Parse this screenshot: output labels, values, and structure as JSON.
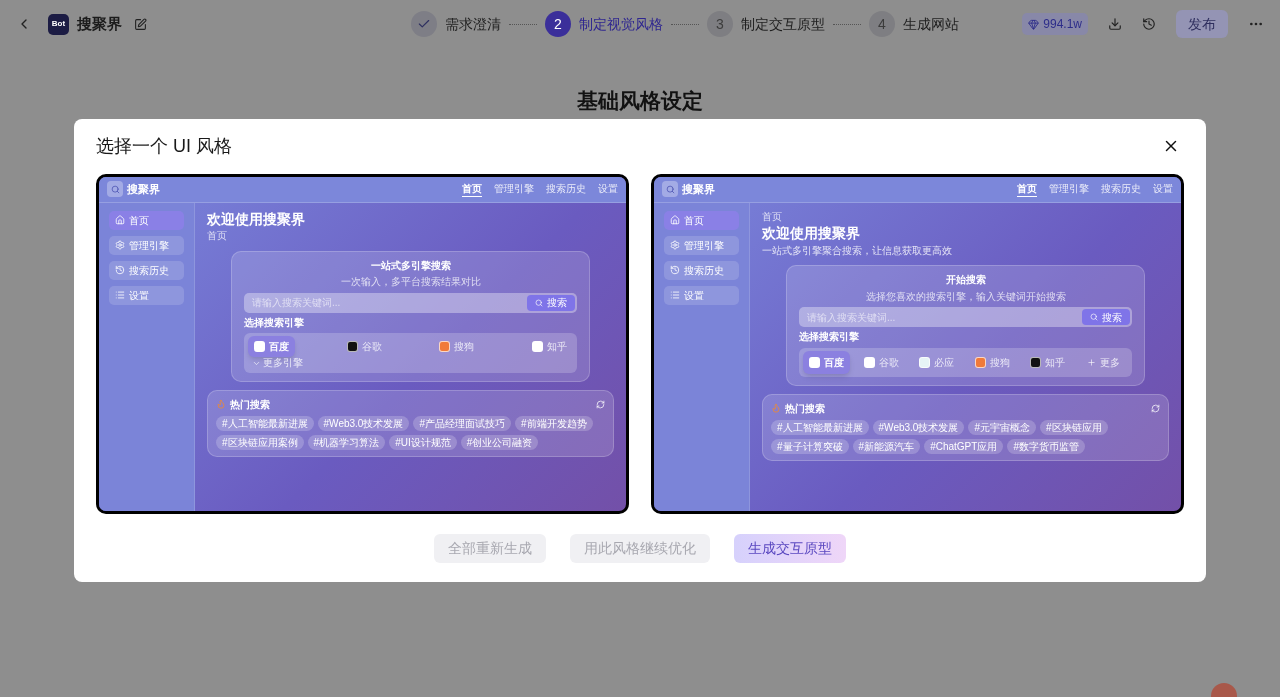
{
  "header": {
    "badge": "Bot",
    "title": "搜聚界",
    "steps": [
      {
        "kind": "done",
        "label": "需求澄清"
      },
      {
        "kind": "active",
        "number": "2",
        "label": "制定视觉风格"
      },
      {
        "kind": "pending",
        "number": "3",
        "label": "制定交互原型"
      },
      {
        "kind": "pending",
        "number": "4",
        "label": "生成网站"
      }
    ],
    "credits": "994.1w",
    "publish": {
      "label": "发布",
      "disabled": true
    }
  },
  "page_title": "基础风格设定",
  "modal": {
    "title": "选择一个 UI 风格",
    "styles": [
      {
        "kind": "title_first",
        "brand": "搜聚界",
        "nav": [
          {
            "label": "首页",
            "selected": true
          },
          {
            "label": "管理引擎",
            "selected": false
          },
          {
            "label": "搜索历史",
            "selected": false
          },
          {
            "label": "设置",
            "selected": false
          }
        ],
        "sidebar": [
          {
            "kind": "home",
            "label": "首页",
            "selected": true
          },
          {
            "kind": "gear",
            "label": "管理引擎",
            "selected": false
          },
          {
            "kind": "history",
            "label": "搜索历史",
            "selected": false
          },
          {
            "kind": "list",
            "label": "设置",
            "selected": false
          }
        ],
        "title": "欢迎使用搜聚界",
        "breadcrumb": "首页",
        "search": {
          "title": "一站式多引擎搜索",
          "subtitle": "一次输入，多平台搜索结果对比",
          "placeholder": "请输入搜索关键词...",
          "button": "搜索",
          "engines_label": "选择搜索引擎",
          "engines": [
            {
              "kind": "engine",
              "label": "百度",
              "selected": true,
              "color": "#ffffff"
            },
            {
              "kind": "engine",
              "label": "谷歌",
              "selected": false,
              "color": "#111111"
            },
            {
              "kind": "engine",
              "label": "搜狗",
              "selected": false,
              "color": "#f07a3a"
            },
            {
              "kind": "engine",
              "label": "知乎",
              "selected": false,
              "color": "#ffffff"
            }
          ],
          "more": "更多引擎"
        },
        "hot": {
          "title": "热门搜索",
          "tags": [
            "#人工智能最新进展",
            "#Web3.0技术发展",
            "#产品经理面试技巧",
            "#前端开发趋势",
            "#区块链应用案例",
            "#机器学习算法",
            "#UI设计规范",
            "#创业公司融资"
          ]
        }
      },
      {
        "kind": "breadcrumb_first",
        "brand": "搜聚界",
        "nav": [
          {
            "label": "首页",
            "selected": true
          },
          {
            "label": "管理引擎",
            "selected": false
          },
          {
            "label": "搜索历史",
            "selected": false
          },
          {
            "label": "设置",
            "selected": false
          }
        ],
        "sidebar": [
          {
            "kind": "home",
            "label": "首页",
            "selected": true
          },
          {
            "kind": "gear",
            "label": "管理引擎",
            "selected": false
          },
          {
            "kind": "history",
            "label": "搜索历史",
            "selected": false
          },
          {
            "kind": "list",
            "label": "设置",
            "selected": false
          }
        ],
        "breadcrumb": "首页",
        "title": "欢迎使用搜聚界",
        "subtitle": "一站式多引擎聚合搜索，让信息获取更高效",
        "search": {
          "title": "开始搜索",
          "subtitle": "选择您喜欢的搜索引擎，输入关键词开始搜索",
          "placeholder": "请输入搜索关键词...",
          "button": "搜索",
          "engines_label": "选择搜索引擎",
          "engines": [
            {
              "kind": "engine",
              "label": "百度",
              "selected": true,
              "color": "#ffffff"
            },
            {
              "kind": "engine",
              "label": "谷歌",
              "selected": false,
              "color": "#ffffff"
            },
            {
              "kind": "engine",
              "label": "必应",
              "selected": false,
              "color": "#e6f4f6"
            },
            {
              "kind": "engine",
              "label": "搜狗",
              "selected": false,
              "color": "#f07a3a"
            },
            {
              "kind": "engine",
              "label": "知乎",
              "selected": false,
              "color": "#111111"
            },
            {
              "kind": "more",
              "label": "更多"
            }
          ]
        },
        "hot": {
          "title": "热门搜索",
          "tags": [
            "#人工智能最新进展",
            "#Web3.0技术发展",
            "#元宇宙概念",
            "#区块链应用",
            "#量子计算突破",
            "#新能源汽车",
            "#ChatGPT应用",
            "#数字货币监管"
          ]
        }
      }
    ],
    "buttons": [
      {
        "label": "全部重新生成",
        "kind": "plain",
        "disabled": true
      },
      {
        "label": "用此风格继续优化",
        "kind": "plain",
        "disabled": true
      },
      {
        "label": "生成交互原型",
        "kind": "primary",
        "disabled": true
      }
    ]
  }
}
